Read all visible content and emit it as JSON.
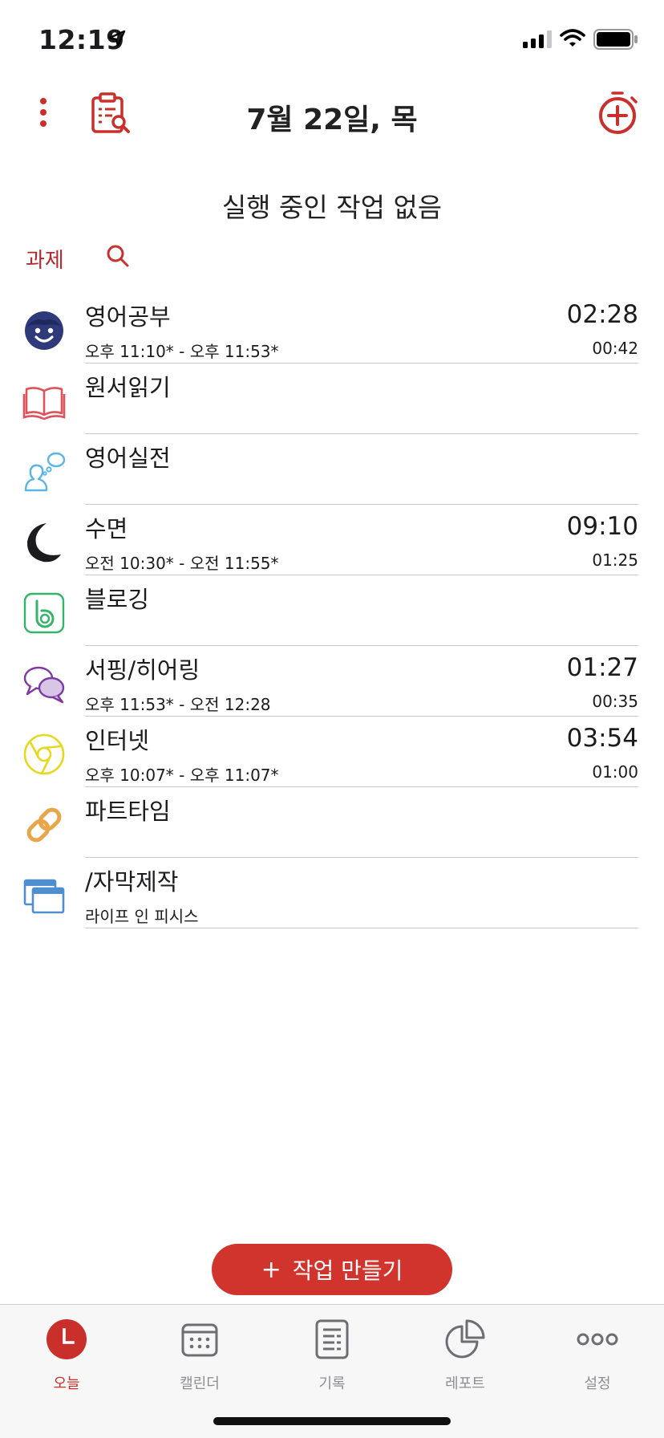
{
  "status_bar": {
    "time": "12:19"
  },
  "header": {
    "title": "7월 22일, 목"
  },
  "running_status": "실행 중인 작업 없음",
  "section": {
    "label": "과제"
  },
  "tasks": [
    {
      "name": "영어공부",
      "sub": "오후 11:10* - 오후 11:53*",
      "total": "02:28",
      "duration": "00:42",
      "icon": "smiley-face-icon",
      "color": "#2e3a7a"
    },
    {
      "name": "원서읽기",
      "sub": "",
      "total": "",
      "duration": "",
      "icon": "open-book-icon",
      "color": "#e0525a"
    },
    {
      "name": "영어실전",
      "sub": "",
      "total": "",
      "duration": "",
      "icon": "speaking-person-icon",
      "color": "#5ab4e6"
    },
    {
      "name": "수면",
      "sub": "오전 10:30* - 오전 11:55*",
      "total": "09:10",
      "duration": "01:25",
      "icon": "moon-icon",
      "color": "#1c1c1e"
    },
    {
      "name": "블로깅",
      "sub": "",
      "total": "",
      "duration": "",
      "icon": "blog-b-icon",
      "color": "#34b36a"
    },
    {
      "name": "서핑/히어링",
      "sub": "오후 11:53* - 오전 12:28",
      "total": "01:27",
      "duration": "00:35",
      "icon": "chat-bubbles-icon",
      "color": "#7e3a9e"
    },
    {
      "name": "인터넷",
      "sub": "오후 10:07* - 오후 11:07*",
      "total": "03:54",
      "duration": "01:00",
      "icon": "browser-circle-icon",
      "color": "#e6d81e"
    },
    {
      "name": "파트타임",
      "sub": "",
      "total": "",
      "duration": "",
      "icon": "chain-link-icon",
      "color": "#e8a64a"
    },
    {
      "name": "/자막제작",
      "sub": "라이프 인 피시스",
      "total": "",
      "duration": "",
      "icon": "windows-icon",
      "color": "#4f8fcf"
    }
  ],
  "create_button": {
    "plus": "+",
    "label": "작업 만들기"
  },
  "tabbar": {
    "today": "오늘",
    "calendar": "캘린더",
    "records": "기록",
    "report": "레포트",
    "settings": "설정"
  },
  "colors": {
    "accent": "#c9302c",
    "button": "#d0342c"
  }
}
